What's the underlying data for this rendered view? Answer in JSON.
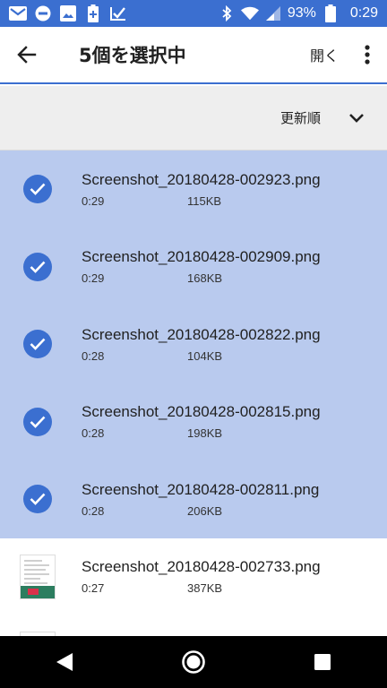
{
  "status_bar": {
    "icons": [
      "gmail-icon",
      "do-not-disturb-icon",
      "image-icon",
      "battery-plus-icon",
      "check-app-icon"
    ],
    "right_icons": [
      "bluetooth-icon",
      "wifi-icon",
      "signal-icon",
      "battery-icon"
    ],
    "battery": "93%",
    "time": "0:29"
  },
  "app_bar": {
    "title": "5個を選択中",
    "open_label": "開く"
  },
  "sort": {
    "label": "更新順"
  },
  "colors": {
    "accent": "#3b6fd0",
    "selected_row": "#b9caee"
  },
  "files": [
    {
      "name": "Screenshot_20180428-002923.png",
      "time": "0:29",
      "size": "115KB",
      "selected": true
    },
    {
      "name": "Screenshot_20180428-002909.png",
      "time": "0:29",
      "size": "168KB",
      "selected": true
    },
    {
      "name": "Screenshot_20180428-002822.png",
      "time": "0:28",
      "size": "104KB",
      "selected": true
    },
    {
      "name": "Screenshot_20180428-002815.png",
      "time": "0:28",
      "size": "198KB",
      "selected": true
    },
    {
      "name": "Screenshot_20180428-002811.png",
      "time": "0:28",
      "size": "206KB",
      "selected": true
    },
    {
      "name": "Screenshot_20180428-002733.png",
      "time": "0:27",
      "size": "387KB",
      "selected": false
    }
  ]
}
